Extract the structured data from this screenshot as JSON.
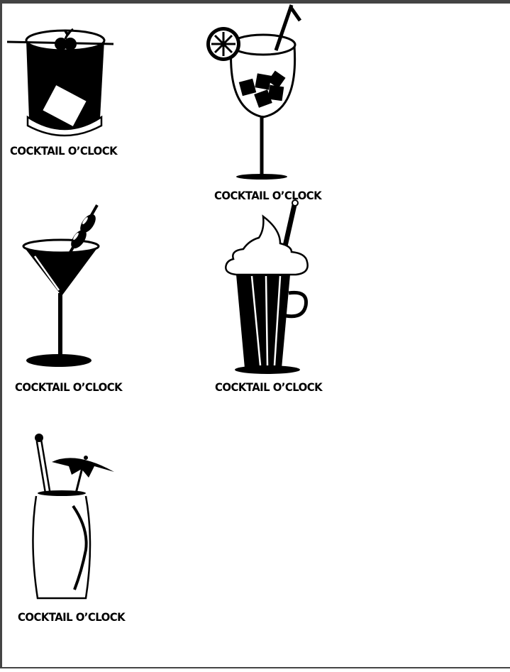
{
  "page": {
    "background": "#ffffff",
    "frame_color": "#444444",
    "ink": "#000000"
  },
  "cards": [
    {
      "id": "old-fashioned",
      "icon": "old-fashioned-glass-icon",
      "label": "COCKTAIL O’CLOCK"
    },
    {
      "id": "wine-glass",
      "icon": "wine-glass-with-ice-icon",
      "label": "COCKTAIL O’CLOCK"
    },
    {
      "id": "martini",
      "icon": "martini-glass-icon",
      "label": "COCKTAIL O’CLOCK"
    },
    {
      "id": "milkshake",
      "icon": "milkshake-glass-icon",
      "label": "COCKTAIL O’CLOCK"
    },
    {
      "id": "highball",
      "icon": "highball-umbrella-icon",
      "label": "COCKTAIL O’CLOCK"
    }
  ]
}
